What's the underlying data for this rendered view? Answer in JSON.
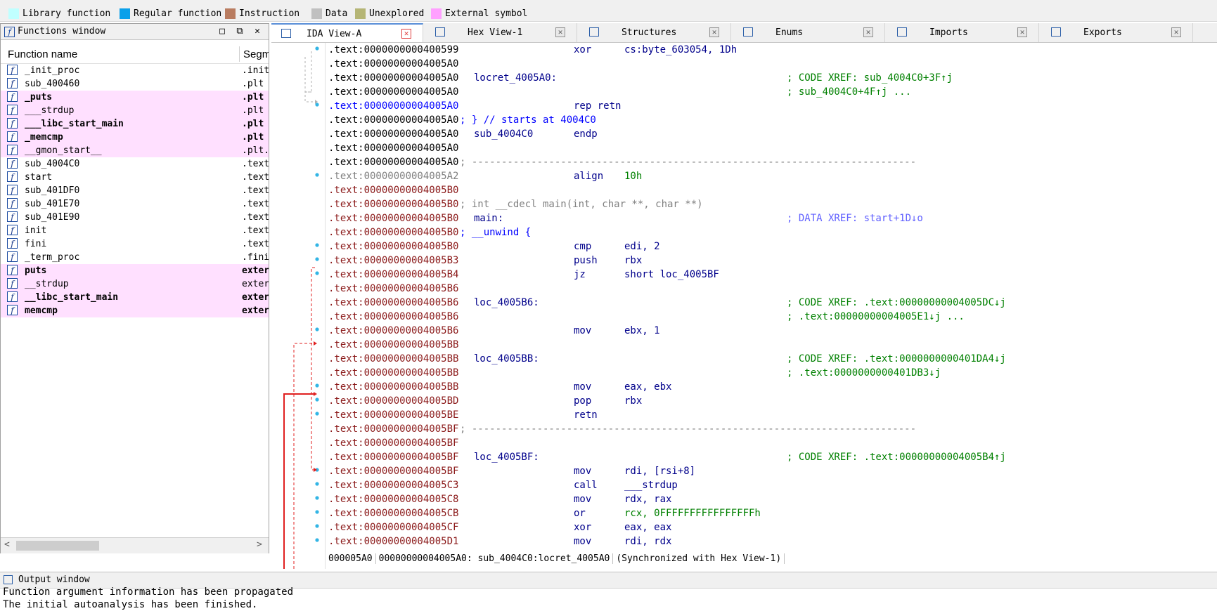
{
  "legend": [
    {
      "label": "Library function",
      "color": "#c0ffff"
    },
    {
      "label": "Regular function",
      "color": "#0aa0ea"
    },
    {
      "label": "Instruction",
      "color": "#b97c60"
    },
    {
      "label": "Data",
      "color": "#c0c0c0"
    },
    {
      "label": "Unexplored",
      "color": "#b5b575"
    },
    {
      "label": "External symbol",
      "color": "#ffa0ff"
    }
  ],
  "functions_window": {
    "title": "Functions window",
    "col_name": "Function name",
    "col_segment": "Segm",
    "rows": [
      {
        "name": "_init_proc",
        "segment": ".init",
        "external": false,
        "bold": false
      },
      {
        "name": "sub_400460",
        "segment": ".plt",
        "external": false,
        "bold": false
      },
      {
        "name": "_puts",
        "segment": ".plt",
        "external": true,
        "bold": true
      },
      {
        "name": "___strdup",
        "segment": ".plt",
        "external": true,
        "bold": false
      },
      {
        "name": "___libc_start_main",
        "segment": ".plt",
        "external": true,
        "bold": true
      },
      {
        "name": "_memcmp",
        "segment": ".plt",
        "external": true,
        "bold": true
      },
      {
        "name": "__gmon_start__",
        "segment": ".plt.",
        "external": true,
        "bold": false
      },
      {
        "name": "sub_4004C0",
        "segment": ".text",
        "external": false,
        "bold": false
      },
      {
        "name": "start",
        "segment": ".text",
        "external": false,
        "bold": false
      },
      {
        "name": "sub_401DF0",
        "segment": ".text",
        "external": false,
        "bold": false
      },
      {
        "name": "sub_401E70",
        "segment": ".text",
        "external": false,
        "bold": false
      },
      {
        "name": "sub_401E90",
        "segment": ".text",
        "external": false,
        "bold": false
      },
      {
        "name": "init",
        "segment": ".text",
        "external": false,
        "bold": false
      },
      {
        "name": "fini",
        "segment": ".text",
        "external": false,
        "bold": false
      },
      {
        "name": "_term_proc",
        "segment": ".fini",
        "external": false,
        "bold": false
      },
      {
        "name": "puts",
        "segment": "exter",
        "external": true,
        "bold": true
      },
      {
        "name": "__strdup",
        "segment": "exter",
        "external": true,
        "bold": false
      },
      {
        "name": "__libc_start_main",
        "segment": "exter",
        "external": true,
        "bold": true
      },
      {
        "name": "memcmp",
        "segment": "exter",
        "external": true,
        "bold": true
      }
    ]
  },
  "tabs": [
    {
      "label": "IDA View-A",
      "active": true
    },
    {
      "label": "Hex View-1",
      "active": false
    },
    {
      "label": "Structures",
      "active": false
    },
    {
      "label": "Enums",
      "active": false
    },
    {
      "label": "Imports",
      "active": false
    },
    {
      "label": "Exports",
      "active": false
    }
  ],
  "code_lines": [
    {
      "addr": ".text:0000000000400599",
      "ac": "",
      "mn": "xor",
      "op": "cs:byte_603054, 1Dh"
    },
    {
      "addr": ".text:00000000004005A0",
      "ac": ""
    },
    {
      "addr": ".text:00000000004005A0",
      "ac": "",
      "lbl": "locret_4005A0:",
      "cm": "; CODE XREF: sub_4004C0+3F↑j",
      "cmc": "cmg"
    },
    {
      "addr": ".text:00000000004005A0",
      "ac": "",
      "cm": "; sub_4004C0+4F↑j ...",
      "cmc": "cmg"
    },
    {
      "addr": ".text:00000000004005A0",
      "ac": "blue",
      "mn": "rep retn",
      "op": ""
    },
    {
      "addr": ".text:00000000004005A0",
      "ac": "",
      "raw": "; } // starts at 4004C0",
      "rc": "cm"
    },
    {
      "addr": ".text:00000000004005A0",
      "ac": "",
      "lbl": "sub_4004C0",
      "mn": "endp",
      "op": ""
    },
    {
      "addr": ".text:00000000004005A0",
      "ac": ""
    },
    {
      "addr": ".text:00000000004005A0",
      "ac": "",
      "raw": "; ---------------------------------------------------------------------------",
      "rc": "sepline"
    },
    {
      "addr": ".text:00000000004005A2",
      "ac": "grey",
      "mn": "align",
      "op": "10h",
      "opn": true
    },
    {
      "addr": ".text:00000000004005B0",
      "ac": "red"
    },
    {
      "addr": ".text:00000000004005B0",
      "ac": "red",
      "raw": "; int __cdecl main(int, char **, char **)",
      "rc": "cmgray"
    },
    {
      "addr": ".text:00000000004005B0",
      "ac": "red",
      "lbl": "main:",
      "cm": "; DATA XREF: start+1D↓o",
      "cmc": "dx"
    },
    {
      "addr": ".text:00000000004005B0",
      "ac": "red",
      "raw": "; __unwind {",
      "rc": "cm"
    },
    {
      "addr": ".text:00000000004005B0",
      "ac": "red",
      "mn": "cmp",
      "op": "edi, 2"
    },
    {
      "addr": ".text:00000000004005B3",
      "ac": "red",
      "mn": "push",
      "op": "rbx"
    },
    {
      "addr": ".text:00000000004005B4",
      "ac": "red",
      "mn": "jz",
      "op": "short loc_4005BF"
    },
    {
      "addr": ".text:00000000004005B6",
      "ac": "red"
    },
    {
      "addr": ".text:00000000004005B6",
      "ac": "red",
      "lbl": "loc_4005B6:",
      "cm": "; CODE XREF: .text:00000000004005DC↓j",
      "cmc": "cmg"
    },
    {
      "addr": ".text:00000000004005B6",
      "ac": "red",
      "cm": "; .text:00000000004005E1↓j ...",
      "cmc": "cmg"
    },
    {
      "addr": ".text:00000000004005B6",
      "ac": "red",
      "mn": "mov",
      "op": "ebx, 1"
    },
    {
      "addr": ".text:00000000004005BB",
      "ac": "red"
    },
    {
      "addr": ".text:00000000004005BB",
      "ac": "red",
      "lbl": "loc_4005BB:",
      "cm": "; CODE XREF: .text:0000000000401DA4↓j",
      "cmc": "cmg"
    },
    {
      "addr": ".text:00000000004005BB",
      "ac": "red",
      "cm": "; .text:0000000000401DB3↓j",
      "cmc": "cmg"
    },
    {
      "addr": ".text:00000000004005BB",
      "ac": "red",
      "mn": "mov",
      "op": "eax, ebx"
    },
    {
      "addr": ".text:00000000004005BD",
      "ac": "red",
      "mn": "pop",
      "op": "rbx"
    },
    {
      "addr": ".text:00000000004005BE",
      "ac": "red",
      "mn": "retn",
      "op": ""
    },
    {
      "addr": ".text:00000000004005BF",
      "ac": "red",
      "raw": "; ---------------------------------------------------------------------------",
      "rc": "sepline"
    },
    {
      "addr": ".text:00000000004005BF",
      "ac": "red"
    },
    {
      "addr": ".text:00000000004005BF",
      "ac": "red",
      "lbl": "loc_4005BF:",
      "cm": "; CODE XREF: .text:00000000004005B4↑j",
      "cmc": "cmg"
    },
    {
      "addr": ".text:00000000004005BF",
      "ac": "red",
      "mn": "mov",
      "op": "rdi, [rsi+8]"
    },
    {
      "addr": ".text:00000000004005C3",
      "ac": "red",
      "mn": "call",
      "op": "___strdup"
    },
    {
      "addr": ".text:00000000004005C8",
      "ac": "red",
      "mn": "mov",
      "op": "rdx, rax"
    },
    {
      "addr": ".text:00000000004005CB",
      "ac": "red",
      "mn": "or",
      "op": "rcx, 0FFFFFFFFFFFFFFFFh",
      "opn": true
    },
    {
      "addr": ".text:00000000004005CF",
      "ac": "red",
      "mn": "xor",
      "op": "eax, eax"
    },
    {
      "addr": ".text:00000000004005D1",
      "ac": "red",
      "mn": "mov",
      "op": "rdi, rdx"
    }
  ],
  "status_bar": {
    "offset": "000005A0",
    "location": "00000000004005A0: sub_4004C0:locret_4005A0",
    "sync": "(Synchronized with Hex View-1)"
  },
  "output_window": {
    "title": "Output window",
    "lines": [
      "Function argument information has been propagated",
      "The initial autoanalysis has been finished."
    ]
  }
}
